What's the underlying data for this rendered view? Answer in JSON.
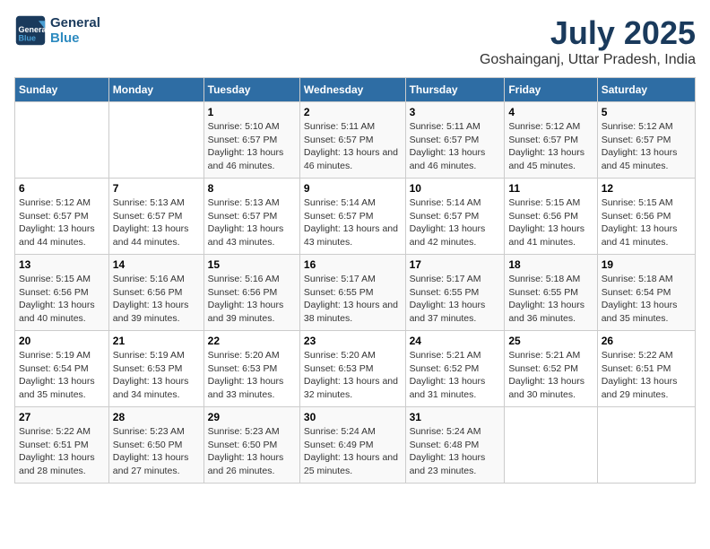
{
  "header": {
    "logo_line1": "General",
    "logo_line2": "Blue",
    "month_year": "July 2025",
    "location": "Goshainganj, Uttar Pradesh, India"
  },
  "weekdays": [
    "Sunday",
    "Monday",
    "Tuesday",
    "Wednesday",
    "Thursday",
    "Friday",
    "Saturday"
  ],
  "weeks": [
    [
      {
        "day": "",
        "info": ""
      },
      {
        "day": "",
        "info": ""
      },
      {
        "day": "1",
        "info": "Sunrise: 5:10 AM\nSunset: 6:57 PM\nDaylight: 13 hours and 46 minutes."
      },
      {
        "day": "2",
        "info": "Sunrise: 5:11 AM\nSunset: 6:57 PM\nDaylight: 13 hours and 46 minutes."
      },
      {
        "day": "3",
        "info": "Sunrise: 5:11 AM\nSunset: 6:57 PM\nDaylight: 13 hours and 46 minutes."
      },
      {
        "day": "4",
        "info": "Sunrise: 5:12 AM\nSunset: 6:57 PM\nDaylight: 13 hours and 45 minutes."
      },
      {
        "day": "5",
        "info": "Sunrise: 5:12 AM\nSunset: 6:57 PM\nDaylight: 13 hours and 45 minutes."
      }
    ],
    [
      {
        "day": "6",
        "info": "Sunrise: 5:12 AM\nSunset: 6:57 PM\nDaylight: 13 hours and 44 minutes."
      },
      {
        "day": "7",
        "info": "Sunrise: 5:13 AM\nSunset: 6:57 PM\nDaylight: 13 hours and 44 minutes."
      },
      {
        "day": "8",
        "info": "Sunrise: 5:13 AM\nSunset: 6:57 PM\nDaylight: 13 hours and 43 minutes."
      },
      {
        "day": "9",
        "info": "Sunrise: 5:14 AM\nSunset: 6:57 PM\nDaylight: 13 hours and 43 minutes."
      },
      {
        "day": "10",
        "info": "Sunrise: 5:14 AM\nSunset: 6:57 PM\nDaylight: 13 hours and 42 minutes."
      },
      {
        "day": "11",
        "info": "Sunrise: 5:15 AM\nSunset: 6:56 PM\nDaylight: 13 hours and 41 minutes."
      },
      {
        "day": "12",
        "info": "Sunrise: 5:15 AM\nSunset: 6:56 PM\nDaylight: 13 hours and 41 minutes."
      }
    ],
    [
      {
        "day": "13",
        "info": "Sunrise: 5:15 AM\nSunset: 6:56 PM\nDaylight: 13 hours and 40 minutes."
      },
      {
        "day": "14",
        "info": "Sunrise: 5:16 AM\nSunset: 6:56 PM\nDaylight: 13 hours and 39 minutes."
      },
      {
        "day": "15",
        "info": "Sunrise: 5:16 AM\nSunset: 6:56 PM\nDaylight: 13 hours and 39 minutes."
      },
      {
        "day": "16",
        "info": "Sunrise: 5:17 AM\nSunset: 6:55 PM\nDaylight: 13 hours and 38 minutes."
      },
      {
        "day": "17",
        "info": "Sunrise: 5:17 AM\nSunset: 6:55 PM\nDaylight: 13 hours and 37 minutes."
      },
      {
        "day": "18",
        "info": "Sunrise: 5:18 AM\nSunset: 6:55 PM\nDaylight: 13 hours and 36 minutes."
      },
      {
        "day": "19",
        "info": "Sunrise: 5:18 AM\nSunset: 6:54 PM\nDaylight: 13 hours and 35 minutes."
      }
    ],
    [
      {
        "day": "20",
        "info": "Sunrise: 5:19 AM\nSunset: 6:54 PM\nDaylight: 13 hours and 35 minutes."
      },
      {
        "day": "21",
        "info": "Sunrise: 5:19 AM\nSunset: 6:53 PM\nDaylight: 13 hours and 34 minutes."
      },
      {
        "day": "22",
        "info": "Sunrise: 5:20 AM\nSunset: 6:53 PM\nDaylight: 13 hours and 33 minutes."
      },
      {
        "day": "23",
        "info": "Sunrise: 5:20 AM\nSunset: 6:53 PM\nDaylight: 13 hours and 32 minutes."
      },
      {
        "day": "24",
        "info": "Sunrise: 5:21 AM\nSunset: 6:52 PM\nDaylight: 13 hours and 31 minutes."
      },
      {
        "day": "25",
        "info": "Sunrise: 5:21 AM\nSunset: 6:52 PM\nDaylight: 13 hours and 30 minutes."
      },
      {
        "day": "26",
        "info": "Sunrise: 5:22 AM\nSunset: 6:51 PM\nDaylight: 13 hours and 29 minutes."
      }
    ],
    [
      {
        "day": "27",
        "info": "Sunrise: 5:22 AM\nSunset: 6:51 PM\nDaylight: 13 hours and 28 minutes."
      },
      {
        "day": "28",
        "info": "Sunrise: 5:23 AM\nSunset: 6:50 PM\nDaylight: 13 hours and 27 minutes."
      },
      {
        "day": "29",
        "info": "Sunrise: 5:23 AM\nSunset: 6:50 PM\nDaylight: 13 hours and 26 minutes."
      },
      {
        "day": "30",
        "info": "Sunrise: 5:24 AM\nSunset: 6:49 PM\nDaylight: 13 hours and 25 minutes."
      },
      {
        "day": "31",
        "info": "Sunrise: 5:24 AM\nSunset: 6:48 PM\nDaylight: 13 hours and 23 minutes."
      },
      {
        "day": "",
        "info": ""
      },
      {
        "day": "",
        "info": ""
      }
    ]
  ]
}
